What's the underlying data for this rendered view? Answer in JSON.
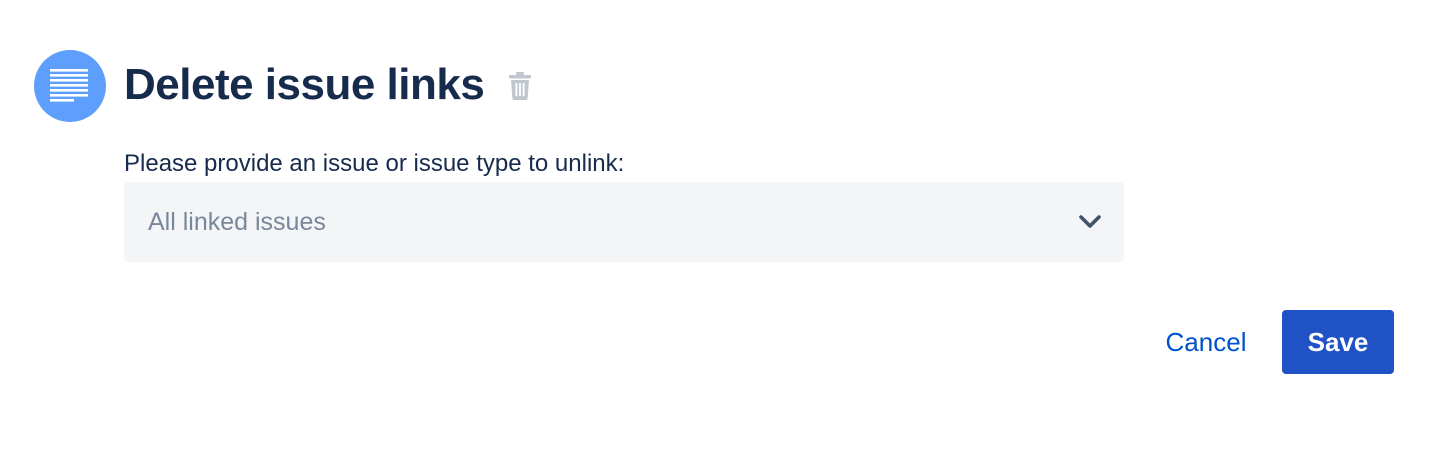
{
  "header": {
    "title": "Delete issue links",
    "avatar_icon": "text-lines-icon",
    "delete_icon": "trash-icon",
    "accent_color": "#5e9efc"
  },
  "form": {
    "label": "Please provide an issue or issue type to unlink:",
    "select": {
      "value": "All linked issues",
      "icon": "chevron-down-icon"
    }
  },
  "actions": {
    "cancel_label": "Cancel",
    "save_label": "Save",
    "primary_color": "#1f52c4",
    "link_color": "#0052cc"
  }
}
